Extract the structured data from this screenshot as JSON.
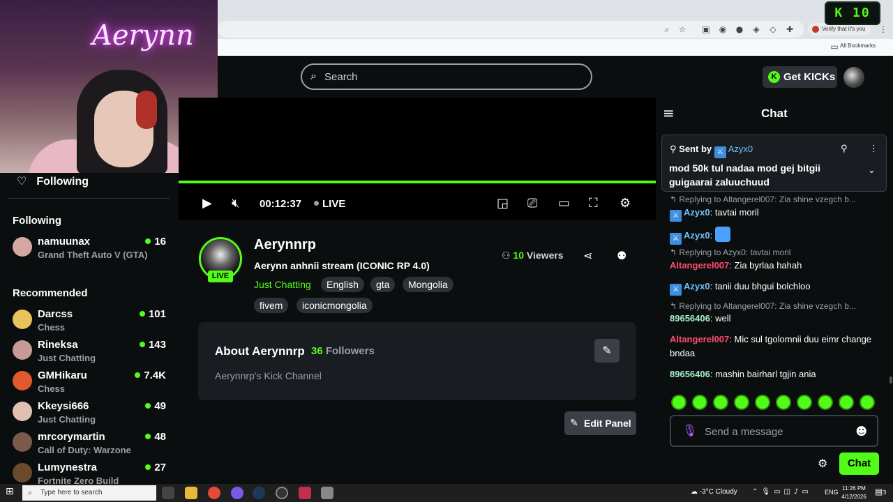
{
  "browser": {
    "verify_text": "Verify that it's you",
    "all_bookmarks": "All Bookmarks"
  },
  "kick_overlay": {
    "label": "10"
  },
  "webcam": {
    "neon_sign": "Aerynn"
  },
  "header": {
    "search_placeholder": "Search",
    "get_kicks_label": "Get KICKs"
  },
  "sidebar": {
    "following_toggle": "Following",
    "following_heading": "Following",
    "recommended_heading": "Recommended",
    "following": [
      {
        "name": "namuunax",
        "category": "Grand Theft Auto V (GTA)",
        "viewers": "16",
        "color": "#d4a8a0"
      }
    ],
    "recommended": [
      {
        "name": "Darcss",
        "category": "Chess",
        "viewers": "101",
        "color": "#e8c35a"
      },
      {
        "name": "Rineksa",
        "category": "Just Chatting",
        "viewers": "143",
        "color": "#c89a96"
      },
      {
        "name": "GMHikaru",
        "category": "Chess",
        "viewers": "7.4K",
        "color": "#e05a2e"
      },
      {
        "name": "Kkeysi666",
        "category": "Just Chatting",
        "viewers": "49",
        "color": "#e0c0b0"
      },
      {
        "name": "mrcorymartin",
        "category": "Call of Duty: Warzone",
        "viewers": "48",
        "color": "#7a5a4a"
      },
      {
        "name": "Lumynestra",
        "category": "Fortnite Zero Build",
        "viewers": "27",
        "color": "#6a4a2a"
      }
    ]
  },
  "player": {
    "time": "00:12:37",
    "live_label": "LIVE",
    "progress_fraction": 1.0
  },
  "channel": {
    "name": "Aerynnrp",
    "live_badge": "LIVE",
    "title": "Aerynn anhnii stream (ICONIC RP 4.0)",
    "category": "Just Chatting",
    "tags": [
      "English",
      "gta",
      "Mongolia",
      "fivem",
      "iconicmongolia"
    ],
    "viewers_count": "10",
    "viewers_label": "Viewers"
  },
  "about": {
    "title": "About Aerynnrp",
    "followers_count": "36",
    "followers_label": "Followers",
    "description": "Aerynnrp's Kick Channel",
    "edit_panel_label": "Edit Panel"
  },
  "chat": {
    "title": "Chat",
    "pinned_sent_by": "Sent by",
    "pinned_user": "Azyx0",
    "pinned_message": "mod 50k tul nadaa mod gej bitgii guigaarai zaluuchuud",
    "messages": [
      {
        "reply": "Replying to Altangerel007: Zia shine vzegch b...",
        "user": "Azyx0",
        "text": "tavtai moril"
      },
      {
        "reply": "",
        "user": "Azyx0",
        "text": ""
      },
      {
        "reply": "Replying to Azyx0: tavtai moril",
        "user": "Altangerel007",
        "text": "Zia byrlaa hahah"
      },
      {
        "reply": "",
        "user": "Azyx0",
        "text": "tanii duu bhgui bolchloo"
      },
      {
        "reply": "Replying to Altangerel007: Zia shine vzegch b...",
        "user": "89656406",
        "text": "well"
      },
      {
        "reply": "",
        "user": "Altangerel007",
        "text": "Mic sul tgolomnii duu eimr change bndaa"
      },
      {
        "reply": "",
        "user": "89656406",
        "text": "mashin bairharl tgjin ania"
      }
    ],
    "input_placeholder": "Send a message",
    "send_label": "Chat"
  },
  "taskbar": {
    "search_placeholder": "Type here to search",
    "weather": "-3°C  Cloudy",
    "lang": "ENG",
    "time": "11:26 PM",
    "date": "4/12/2026",
    "notif_count": "3"
  },
  "colors": {
    "accent": "#53fc18",
    "background": "#0b0e0f",
    "panel": "#191d21"
  }
}
